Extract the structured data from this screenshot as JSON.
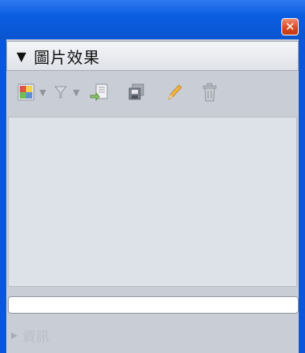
{
  "window": {
    "close_symbol": "✕"
  },
  "section": {
    "toggle_symbol": "▼",
    "title": "圖片效果"
  },
  "toolbar": {
    "buttons": [
      {
        "icon": "image-effects-icon"
      },
      {
        "icon": "filter-icon"
      },
      {
        "icon": "insert-into-document-icon"
      },
      {
        "icon": "save-icon"
      },
      {
        "icon": "pencil-icon"
      },
      {
        "icon": "trash-icon"
      }
    ],
    "dropdown_symbol": "▼"
  },
  "input": {
    "value": "",
    "placeholder": ""
  },
  "info": {
    "toggle_symbol": "▶",
    "label": "資訊"
  },
  "colors": {
    "titlebar_blue": "#0a58d8",
    "panel_gray": "#c9cdd6",
    "list_bg": "#dde1e8",
    "close_red": "#d5461f"
  }
}
